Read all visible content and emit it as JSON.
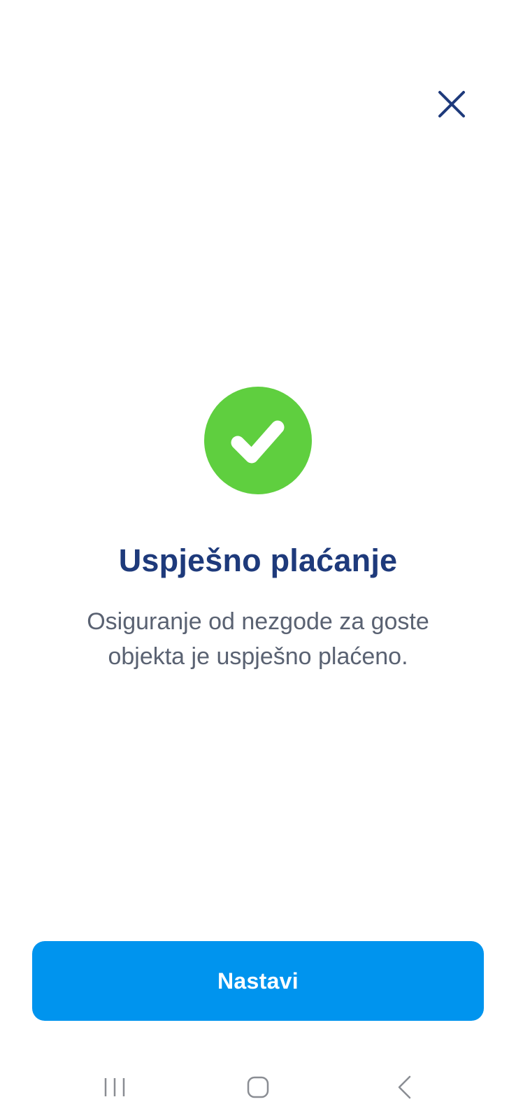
{
  "colors": {
    "background": "#ffffff",
    "navy": "#1e3a7b",
    "success_green": "#5fcf3f",
    "primary_blue": "#0094ee",
    "body_text": "#5a6272",
    "nav_icon": "#8a8d93"
  },
  "header": {
    "close_icon": "close-icon"
  },
  "status": {
    "icon": "checkmark-icon",
    "title": "Uspješno plaćanje",
    "message": "Osiguranje od nezgode za goste objekta je uspješno plaćeno."
  },
  "actions": {
    "continue_label": "Nastavi"
  },
  "system_nav": {
    "recents_icon": "recents-icon",
    "home_icon": "home-icon",
    "back_icon": "back-icon"
  }
}
